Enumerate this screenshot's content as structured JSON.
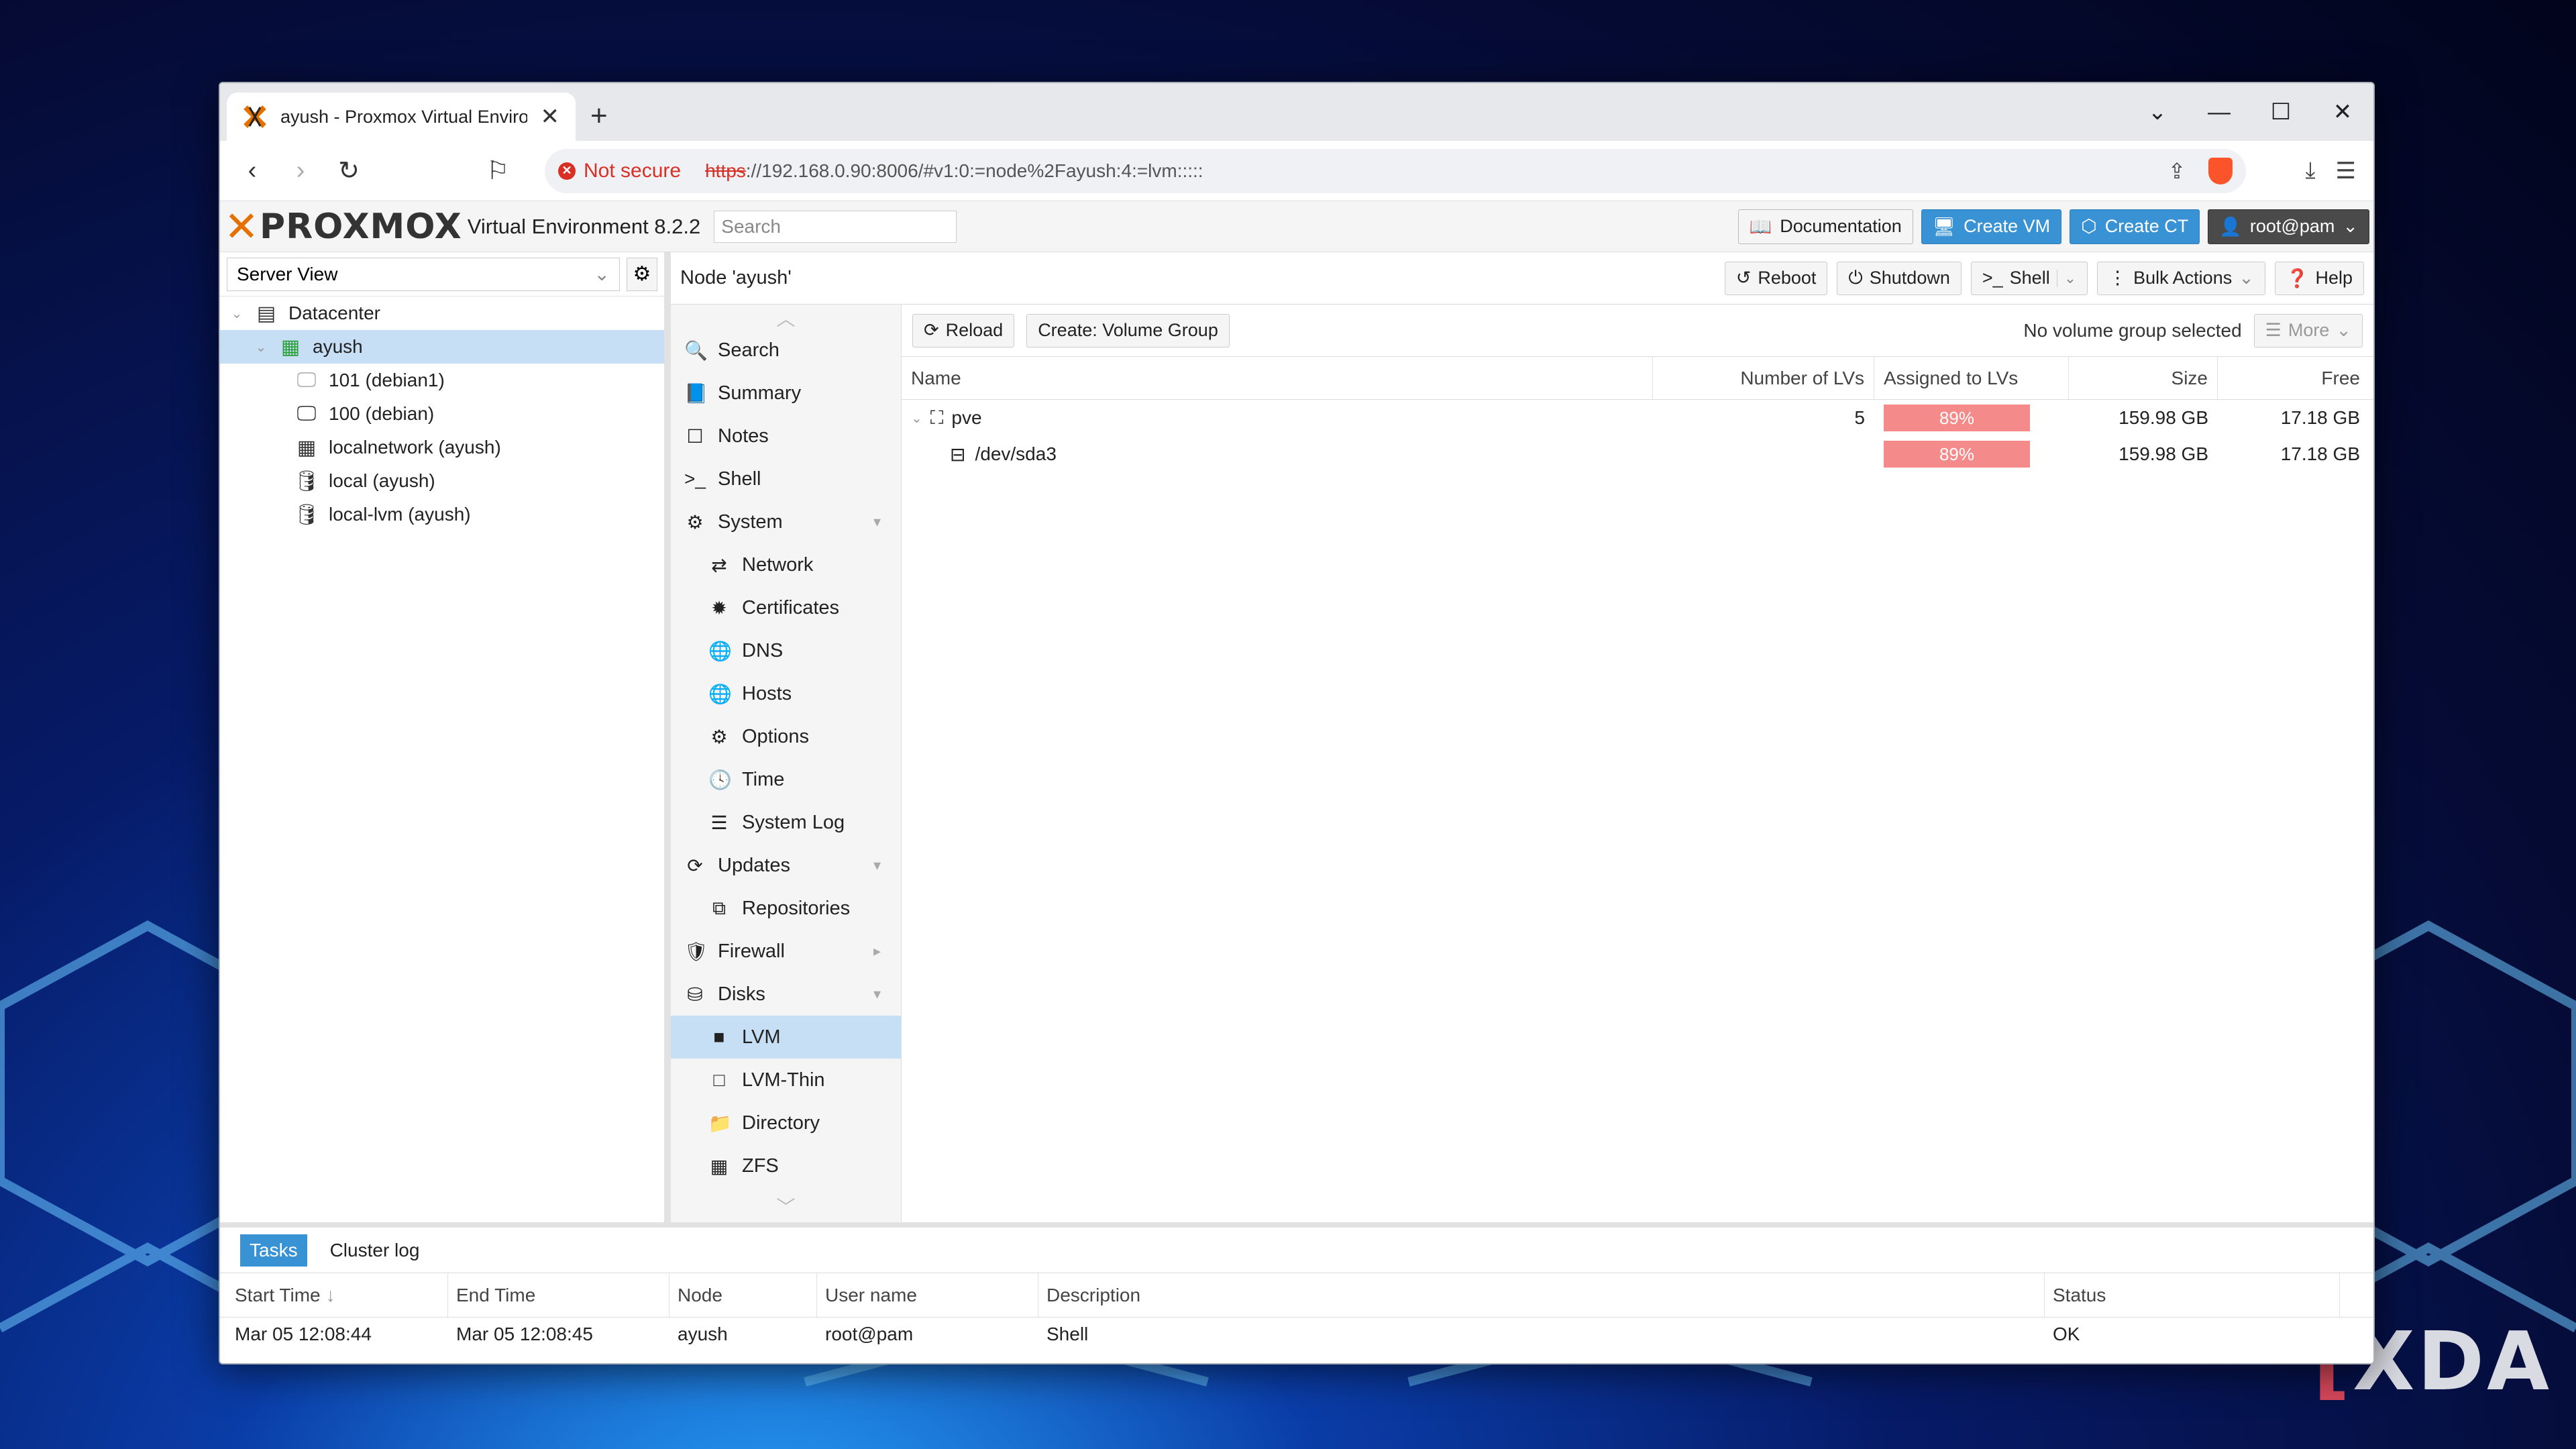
{
  "browser": {
    "tab_title": "ayush - Proxmox Virtual Environ",
    "not_secure": "Not secure",
    "url_scheme": "https",
    "url_rest": "://192.168.0.90:8006/#v1:0:=node%2Fayush:4:=lvm:::::"
  },
  "header": {
    "logo": "PROXMOX",
    "version": "Virtual Environment 8.2.2",
    "search_placeholder": "Search",
    "documentation": "Documentation",
    "create_vm": "Create VM",
    "create_ct": "Create CT",
    "user": "root@pam"
  },
  "tree": {
    "view": "Server View",
    "items": [
      {
        "label": "Datacenter"
      },
      {
        "label": "ayush"
      },
      {
        "label": "101 (debian1)"
      },
      {
        "label": "100 (debian)"
      },
      {
        "label": "localnetwork (ayush)"
      },
      {
        "label": "local (ayush)"
      },
      {
        "label": "local-lvm (ayush)"
      }
    ]
  },
  "node": {
    "title": "Node 'ayush'",
    "reboot": "Reboot",
    "shutdown": "Shutdown",
    "shell": "Shell",
    "bulk_actions": "Bulk Actions",
    "help": "Help"
  },
  "menu": {
    "items": [
      {
        "label": "Search"
      },
      {
        "label": "Summary"
      },
      {
        "label": "Notes"
      },
      {
        "label": "Shell"
      },
      {
        "label": "System"
      },
      {
        "label": "Network"
      },
      {
        "label": "Certificates"
      },
      {
        "label": "DNS"
      },
      {
        "label": "Hosts"
      },
      {
        "label": "Options"
      },
      {
        "label": "Time"
      },
      {
        "label": "System Log"
      },
      {
        "label": "Updates"
      },
      {
        "label": "Repositories"
      },
      {
        "label": "Firewall"
      },
      {
        "label": "Disks"
      },
      {
        "label": "LVM"
      },
      {
        "label": "LVM-Thin"
      },
      {
        "label": "Directory"
      },
      {
        "label": "ZFS"
      }
    ]
  },
  "lvm": {
    "reload": "Reload",
    "create_vg": "Create: Volume Group",
    "no_selection": "No volume group selected",
    "more": "More",
    "columns": [
      "Name",
      "Number of LVs",
      "Assigned to LVs",
      "Size",
      "Free"
    ],
    "rows": [
      {
        "name": "pve",
        "lvs": "5",
        "assigned": "89%",
        "size": "159.98 GB",
        "free": "17.18 GB"
      },
      {
        "name": "/dev/sda3",
        "lvs": "",
        "assigned": "89%",
        "size": "159.98 GB",
        "free": "17.18 GB"
      }
    ]
  },
  "tasks": {
    "tab_tasks": "Tasks",
    "tab_cluster": "Cluster log",
    "columns": [
      "Start Time",
      "End Time",
      "Node",
      "User name",
      "Description",
      "Status"
    ],
    "rows": [
      {
        "start": "Mar 05 12:08:44",
        "end": "Mar 05 12:08:45",
        "node": "ayush",
        "user": "root@pam",
        "desc": "Shell",
        "status": "OK"
      }
    ]
  },
  "watermark": "XDA"
}
